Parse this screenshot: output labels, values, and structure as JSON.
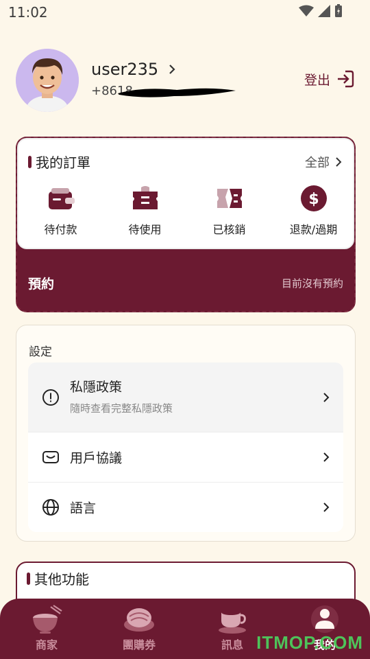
{
  "status_bar": {
    "time": "11:02",
    "icons": [
      "wifi-icon",
      "signal-icon",
      "battery-icon"
    ]
  },
  "profile": {
    "username": "user235",
    "phone": "+8618",
    "logout_label": "登出"
  },
  "orders": {
    "title": "我的訂單",
    "all_label": "全部",
    "items": [
      {
        "label": "待付款",
        "icon": "wallet-icon"
      },
      {
        "label": "待使用",
        "icon": "ticket-icon"
      },
      {
        "label": "已核銷",
        "icon": "used-ticket-icon"
      },
      {
        "label": "退款/過期",
        "icon": "dollar-icon"
      }
    ],
    "booking_label": "預約",
    "booking_status": "目前沒有預約"
  },
  "settings": {
    "title": "設定",
    "items": [
      {
        "label": "私隱政策",
        "sub": "隨時查看完整私隱政策",
        "icon": "info-circle-icon"
      },
      {
        "label": "用戶協議",
        "icon": "mail-icon"
      },
      {
        "label": "語言",
        "icon": "globe-icon"
      }
    ]
  },
  "other": {
    "title": "其他功能"
  },
  "nav": {
    "items": [
      {
        "label": "商家",
        "icon": "noodle-bowl-icon"
      },
      {
        "label": "團購券",
        "icon": "dumpling-icon"
      },
      {
        "label": "訊息",
        "icon": "coffee-cup-icon"
      },
      {
        "label": "我的",
        "icon": "user-icon"
      }
    ],
    "active": "我的"
  },
  "watermark": "ITMOP.COM",
  "colors": {
    "brand": "#6b1a31",
    "background": "#fdf7ea",
    "watermark": "#4ec35a"
  }
}
